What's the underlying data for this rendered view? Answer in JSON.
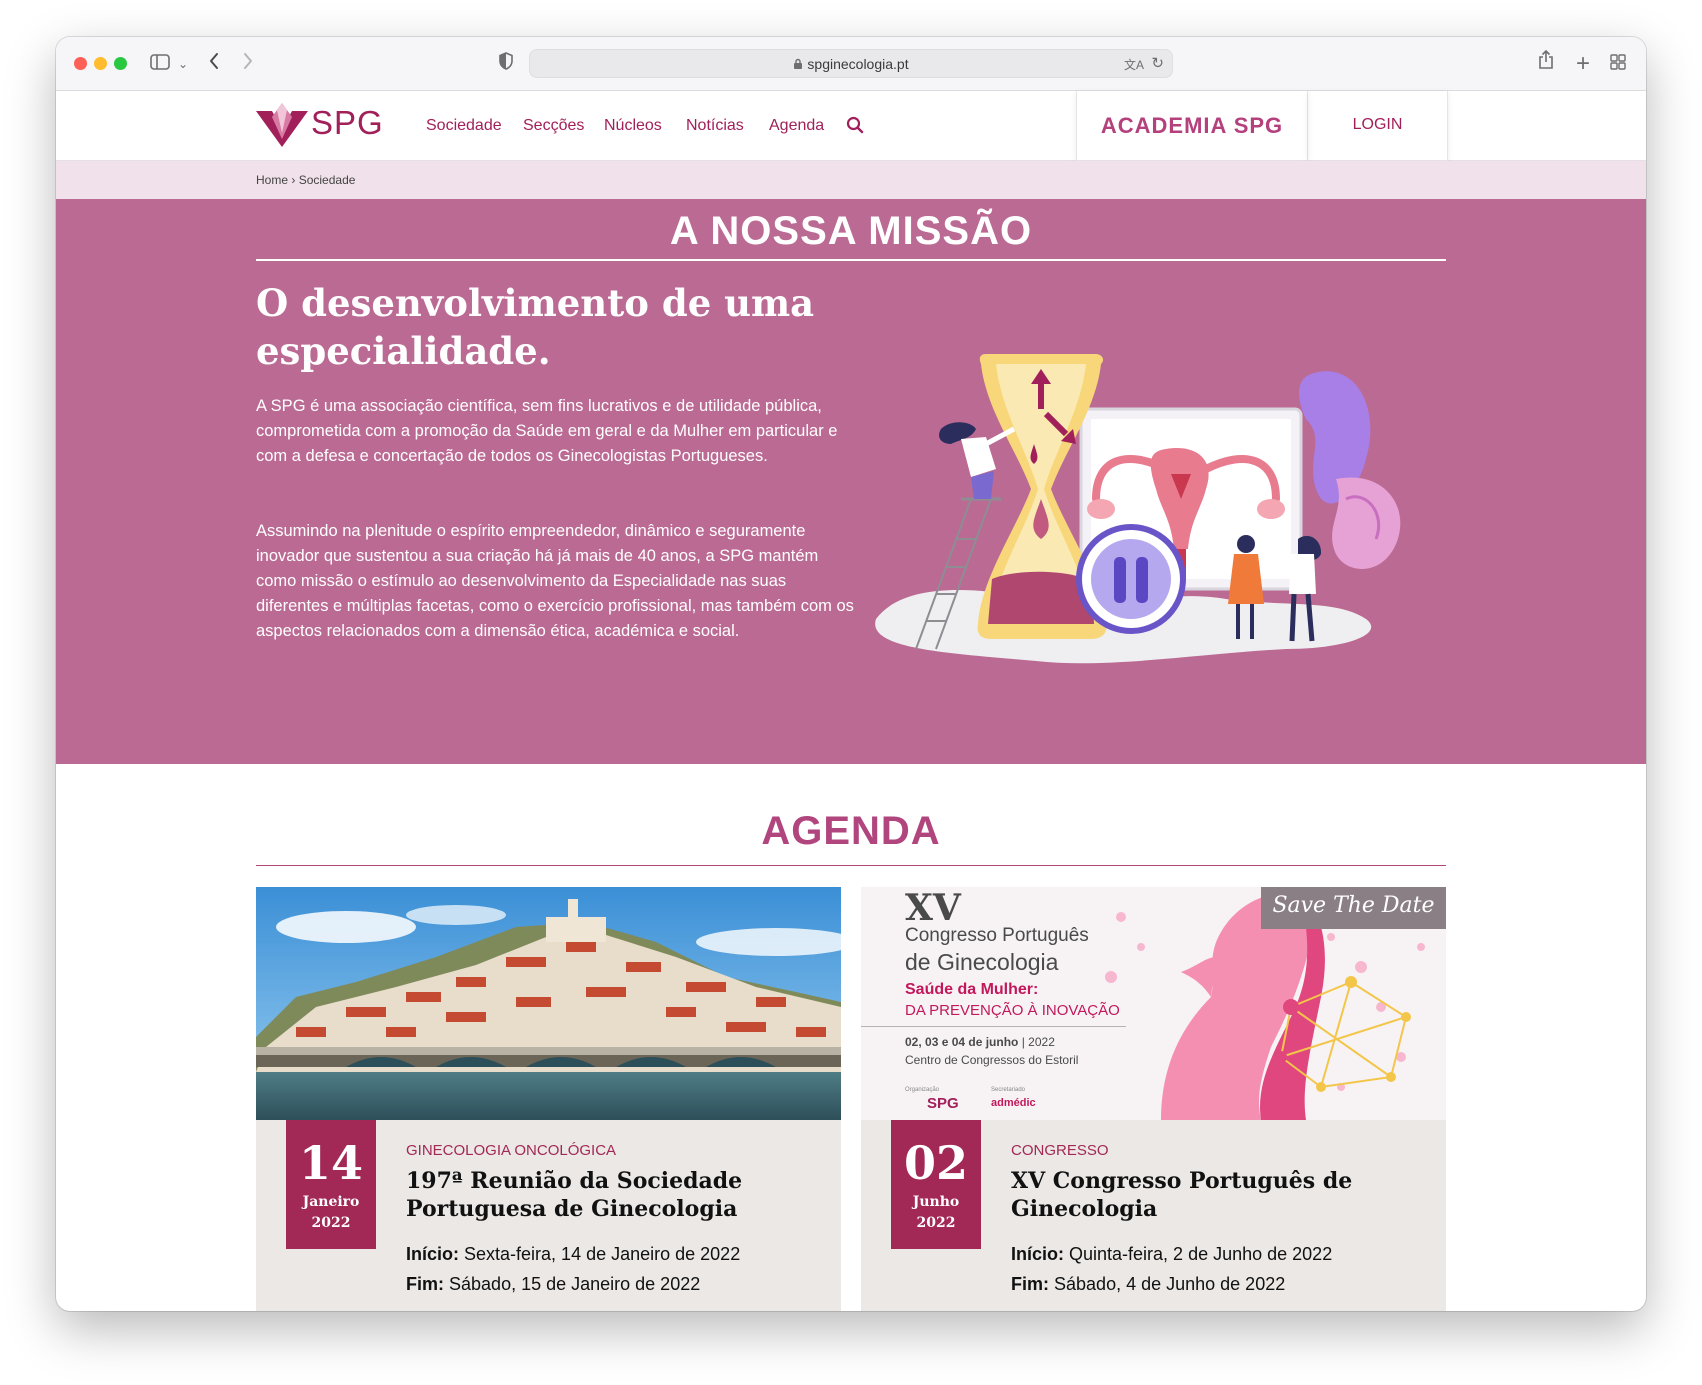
{
  "browser": {
    "url": "spginecologia.pt"
  },
  "header": {
    "logo_text": "SPG",
    "nav": [
      "Sociedade",
      "Secções",
      "Núcleos",
      "Notícias",
      "Agenda"
    ],
    "academia_label": "ACADEMIA SPG",
    "login_label": "LOGIN",
    "search_icon": "search-icon"
  },
  "breadcrumb": {
    "home": "Home",
    "separator": "›",
    "current": "Sociedade"
  },
  "hero": {
    "title": "A NOSSA MISSÃO",
    "heading": "O desenvolvimento de uma especialidade.",
    "paragraph1": "A SPG é uma associação científica, sem fins lucrativos e de utilidade pública, comprometida com a promoção da Saúde em geral e da Mulher em particular e com a defesa e concertação de todos os Ginecologistas Portugueses.",
    "paragraph2": "Assumindo na plenitude o espírito empreendedor, dinâmico e seguramente inovador que sustentou a sua criação há já mais de 40 anos, a SPG mantém como missão o estímulo ao desenvolvimento da Especialidade nas suas diferentes e múltiplas facetas, como o exercício profissional, mas também com os aspectos relacionados com a dimensão ética, académica e social.",
    "background_color": "#bb6a93"
  },
  "agenda": {
    "title": "AGENDA",
    "events": [
      {
        "day": "14",
        "month": "Janeiro",
        "year": "2022",
        "category": "GINECOLOGIA ONCOLÓGICA",
        "title": "197ª Reunião da Sociedade Portuguesa de Ginecologia",
        "start_label": "Início:",
        "start": "Sexta-feira, 14 de Janeiro de 2022",
        "end_label": "Fim:",
        "end": "Sábado, 15 de Janeiro de 2022"
      },
      {
        "day": "02",
        "month": "Junho",
        "year": "2022",
        "category": "CONGRESSO",
        "title": "XV Congresso Português de Ginecologia",
        "start_label": "Início:",
        "start": "Quinta-feira, 2 de Junho de 2022",
        "end_label": "Fim:",
        "end": "Sábado, 4 de Junho de 2022"
      }
    ]
  },
  "poster": {
    "roman": "XV",
    "line1": "Congresso Português",
    "line2": "de Ginecologia",
    "subtitle1": "Saúde da Mulher:",
    "subtitle2": "DA PREVENÇÃO À INOVAÇÃO",
    "dates": "02, 03 e 04 de junho",
    "year": "| 2022",
    "venue": "Centro de Congressos do Estoril",
    "save_the_date": "Save The Date",
    "org_label": "Organização",
    "sec_label": "Secretariado",
    "sponsor": "admédic",
    "spg_logo": "SPG"
  },
  "colors": {
    "brand": "#a2205a",
    "agenda_title": "#b1467f",
    "breadcrumb_bg": "#f1e1ea",
    "card_bg": "#ebe8e6"
  }
}
